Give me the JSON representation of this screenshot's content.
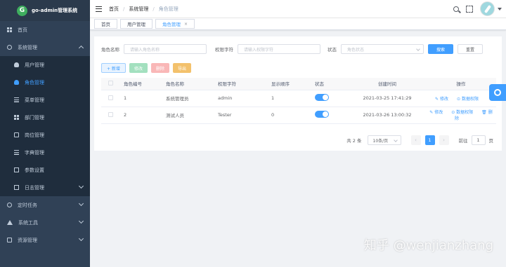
{
  "app": {
    "title": "go-admin管理系统",
    "logo_letter": "G"
  },
  "sidebar": {
    "items": [
      {
        "label": "首页",
        "icon": "dashboard-icon"
      },
      {
        "label": "系统管理",
        "icon": "settings-icon",
        "expanded": true
      },
      {
        "label": "用户管理",
        "icon": "user-icon"
      },
      {
        "label": "角色管理",
        "icon": "peoples-icon",
        "active": true
      },
      {
        "label": "菜单管理",
        "icon": "tree-table-icon"
      },
      {
        "label": "部门管理",
        "icon": "tree-icon"
      },
      {
        "label": "岗位管理",
        "icon": "post-icon"
      },
      {
        "label": "字典管理",
        "icon": "dict-icon"
      },
      {
        "label": "参数设置",
        "icon": "edit-icon"
      },
      {
        "label": "日志管理",
        "icon": "log-icon"
      },
      {
        "label": "定时任务",
        "icon": "job-icon"
      },
      {
        "label": "系统工具",
        "icon": "tool-icon"
      },
      {
        "label": "资源管理",
        "icon": "resource-icon"
      }
    ]
  },
  "breadcrumb": [
    "首页",
    "系统管理",
    "角色管理"
  ],
  "tags": [
    {
      "label": "首页"
    },
    {
      "label": "用户管理"
    },
    {
      "label": "角色管理",
      "active": true,
      "close": "×"
    }
  ],
  "search": {
    "role_name_label": "角色名称",
    "role_name_placeholder": "请输入角色名称",
    "role_key_label": "权限字符",
    "role_key_placeholder": "请输入权限字符",
    "status_label": "状态",
    "status_placeholder": "角色状态",
    "search_btn": "搜索",
    "reset_btn": "重置"
  },
  "toolbar": {
    "add": "+ 新增",
    "edit": "修改",
    "delete": "删除",
    "export": "导出"
  },
  "table": {
    "columns": [
      "角色编号",
      "角色名称",
      "权限字符",
      "显示顺序",
      "状态",
      "创建时间",
      "操作"
    ],
    "rows": [
      {
        "id": "1",
        "name": "系统管理员",
        "key": "admin",
        "sort": "1",
        "status": true,
        "created": "2021-03-25 17:41:29",
        "ops": [
          "修改",
          "数据权限"
        ]
      },
      {
        "id": "2",
        "name": "测试人员",
        "key": "Tester",
        "sort": "0",
        "status": true,
        "created": "2021-03-26 13:00:32",
        "ops": [
          "修改",
          "数据权限",
          "删除"
        ]
      }
    ]
  },
  "pagination": {
    "total": "共 2 条",
    "page_size": "10条/页",
    "current_page": "1",
    "goto_label": "前往",
    "goto_value": "1",
    "page_suffix": "页",
    "prev": "‹",
    "next": "›"
  },
  "watermark": "知乎 @wenjianzhang",
  "colors": {
    "sidebar_bg": "#304156",
    "primary": "#409eff"
  }
}
